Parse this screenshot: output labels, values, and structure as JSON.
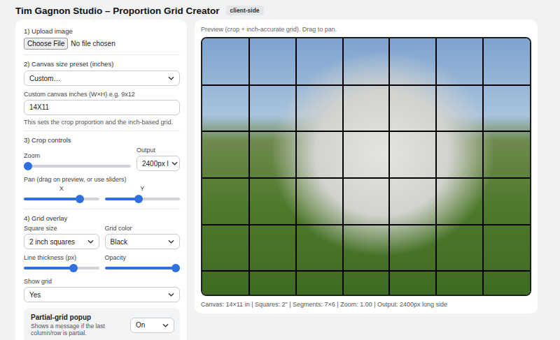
{
  "header": {
    "title": "Tim Gagnon Studio – Proportion Grid Creator",
    "badge": "client-side"
  },
  "upload": {
    "heading": "1) Upload image",
    "button": "Choose File",
    "file": "No file chosen"
  },
  "canvas": {
    "heading": "2) Canvas size preset (inches)",
    "preset": "Custom…",
    "custom_label": "Custom canvas inches (W×H) e.g. 9x12",
    "custom_value": "14X11",
    "hint": "This sets the crop proportion and the inch-based grid."
  },
  "crop": {
    "heading": "3) Crop controls",
    "zoom": {
      "label": "Zoom",
      "level": 0.0
    },
    "output": {
      "label": "Output",
      "value": "2400px l"
    },
    "pan_label": "Pan (drag on preview, or use sliders)",
    "pan": [
      {
        "label": "X",
        "level": 0.77
      },
      {
        "label": "Y",
        "level": 0.45
      }
    ]
  },
  "grid_overlay": {
    "heading": "4) Grid overlay",
    "square_size": {
      "label": "Square size",
      "value": "2 inch squares"
    },
    "grid_color": {
      "label": "Grid color",
      "value": "Black"
    },
    "line_thickness": {
      "label": "Line thickness (px)",
      "level": 0.68
    },
    "opacity": {
      "label": "Opacity",
      "level": 1.0
    },
    "show_grid": {
      "label": "Show grid",
      "value": "Yes"
    }
  },
  "popup": {
    "title": "Partial-grid popup",
    "description": "Shows a message if the last column/row is partial.",
    "value": "On"
  },
  "preview": {
    "caption": "Preview (crop + inch-accurate grid). Drag to pan.",
    "grid": {
      "shown": true,
      "columns": 7,
      "rows": 5.5,
      "color": "#000000"
    },
    "status": "Canvas: 14×11 in | Squares: 2\" | Segments: 7×6 | Zoom: 1.00 | Output: 2400px long side"
  }
}
